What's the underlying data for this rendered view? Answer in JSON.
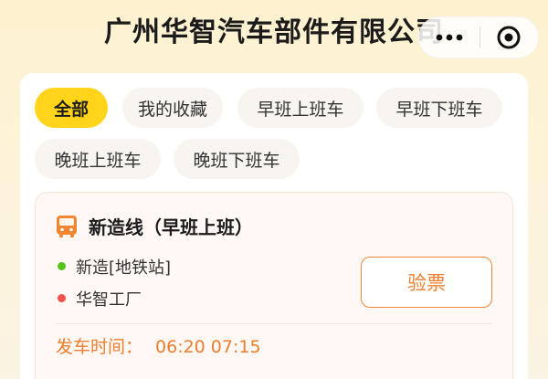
{
  "header": {
    "title": "广州华智汽车部件有限公司",
    "more_icon": "more-dots-icon",
    "close_icon": "target-circle-icon"
  },
  "filters": {
    "chips": [
      {
        "label": "全部",
        "active": true
      },
      {
        "label": "我的收藏",
        "active": false
      },
      {
        "label": "早班上班车",
        "active": false
      },
      {
        "label": "早班下班车",
        "active": false
      },
      {
        "label": "晚班上班车",
        "active": false
      },
      {
        "label": "晚班下班车",
        "active": false
      }
    ]
  },
  "route": {
    "name": "新造线（早班上班）",
    "icon": "bus-icon",
    "start_stop": "新造[地铁站]",
    "end_stop": "华智工厂",
    "start_color": "#52c41a",
    "end_color": "#f5504a",
    "check_label": "验票",
    "depart_label": "发车时间：",
    "depart_times": "06:20 07:15"
  },
  "colors": {
    "accent": "#ffd41a",
    "orange": "#ee7d2d"
  }
}
